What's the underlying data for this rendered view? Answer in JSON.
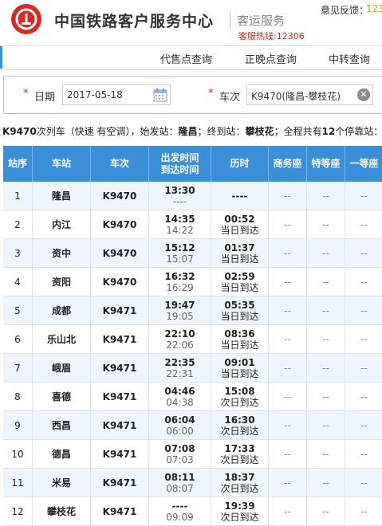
{
  "header": {
    "title": "中国铁路客户服务中心",
    "subtitle": "客运服务",
    "hotline": "客服热线:12306",
    "feedback_label": "意见反馈：",
    "feedback_number": "123",
    "logo_icon": "railway-logo-icon",
    "brand_color": "#e0261c"
  },
  "nav": {
    "items": [
      "代售点查询",
      "正晚点查询",
      "中转查询"
    ]
  },
  "query": {
    "required_mark": "*",
    "date_label": "日期",
    "date_value": "2017-05-18",
    "train_label": "车次",
    "train_value": "K9470(隆昌-攀枝花)",
    "clear_glyph": "✕"
  },
  "summary": {
    "train": "K9470",
    "type_text": "次列车（快速 有空调），始发站：",
    "origin": "隆昌",
    "mid_text": "；终到站：",
    "destination": "攀枝花",
    "stops_text": "；全程共有",
    "stop_count": "12",
    "tail_text": "个停靠站："
  },
  "table": {
    "header_color": "#3b8fd9",
    "headers": {
      "index": "站序",
      "station": "车站",
      "train": "车次",
      "depart": "出发时间",
      "arrive": "到达时间",
      "duration": "历时",
      "business": "商务座",
      "special": "特等座",
      "first": "一等座"
    },
    "rows": [
      {
        "index": "1",
        "station": "隆昌",
        "train": "K9470",
        "depart": "13:30",
        "arrive": "----",
        "duration": "----",
        "day": "",
        "business": "--",
        "special": "--",
        "first": "--"
      },
      {
        "index": "2",
        "station": "内江",
        "train": "K9470",
        "depart": "14:35",
        "arrive": "14:22",
        "duration": "00:52",
        "day": "当日到达",
        "business": "--",
        "special": "--",
        "first": "--"
      },
      {
        "index": "3",
        "station": "资中",
        "train": "K9470",
        "depart": "15:12",
        "arrive": "15:07",
        "duration": "01:37",
        "day": "当日到达",
        "business": "--",
        "special": "--",
        "first": "--"
      },
      {
        "index": "4",
        "station": "资阳",
        "train": "K9470",
        "depart": "16:32",
        "arrive": "16:29",
        "duration": "02:59",
        "day": "当日到达",
        "business": "--",
        "special": "--",
        "first": "--"
      },
      {
        "index": "5",
        "station": "成都",
        "train": "K9471",
        "depart": "19:47",
        "arrive": "19:05",
        "duration": "05:35",
        "day": "当日到达",
        "business": "--",
        "special": "--",
        "first": "--"
      },
      {
        "index": "6",
        "station": "乐山北",
        "train": "K9471",
        "depart": "22:10",
        "arrive": "22:06",
        "duration": "08:36",
        "day": "当日到达",
        "business": "--",
        "special": "--",
        "first": "--"
      },
      {
        "index": "7",
        "station": "峨眉",
        "train": "K9471",
        "depart": "22:35",
        "arrive": "22:31",
        "duration": "09:01",
        "day": "当日到达",
        "business": "--",
        "special": "--",
        "first": "--"
      },
      {
        "index": "8",
        "station": "喜德",
        "train": "K9471",
        "depart": "04:46",
        "arrive": "04:38",
        "duration": "15:08",
        "day": "次日到达",
        "business": "--",
        "special": "--",
        "first": "--"
      },
      {
        "index": "9",
        "station": "西昌",
        "train": "K9471",
        "depart": "06:04",
        "arrive": "06:00",
        "duration": "16:30",
        "day": "次日到达",
        "business": "--",
        "special": "--",
        "first": "--"
      },
      {
        "index": "10",
        "station": "德昌",
        "train": "K9471",
        "depart": "07:08",
        "arrive": "07:03",
        "duration": "17:33",
        "day": "次日到达",
        "business": "--",
        "special": "--",
        "first": "--"
      },
      {
        "index": "11",
        "station": "米易",
        "train": "K9471",
        "depart": "08:11",
        "arrive": "08:07",
        "duration": "18:37",
        "day": "次日到达",
        "business": "--",
        "special": "--",
        "first": "--"
      },
      {
        "index": "12",
        "station": "攀枝花",
        "train": "K9471",
        "depart": "----",
        "arrive": "09:09",
        "duration": "19:39",
        "day": "次日到达",
        "business": "--",
        "special": "--",
        "first": "--"
      }
    ]
  }
}
